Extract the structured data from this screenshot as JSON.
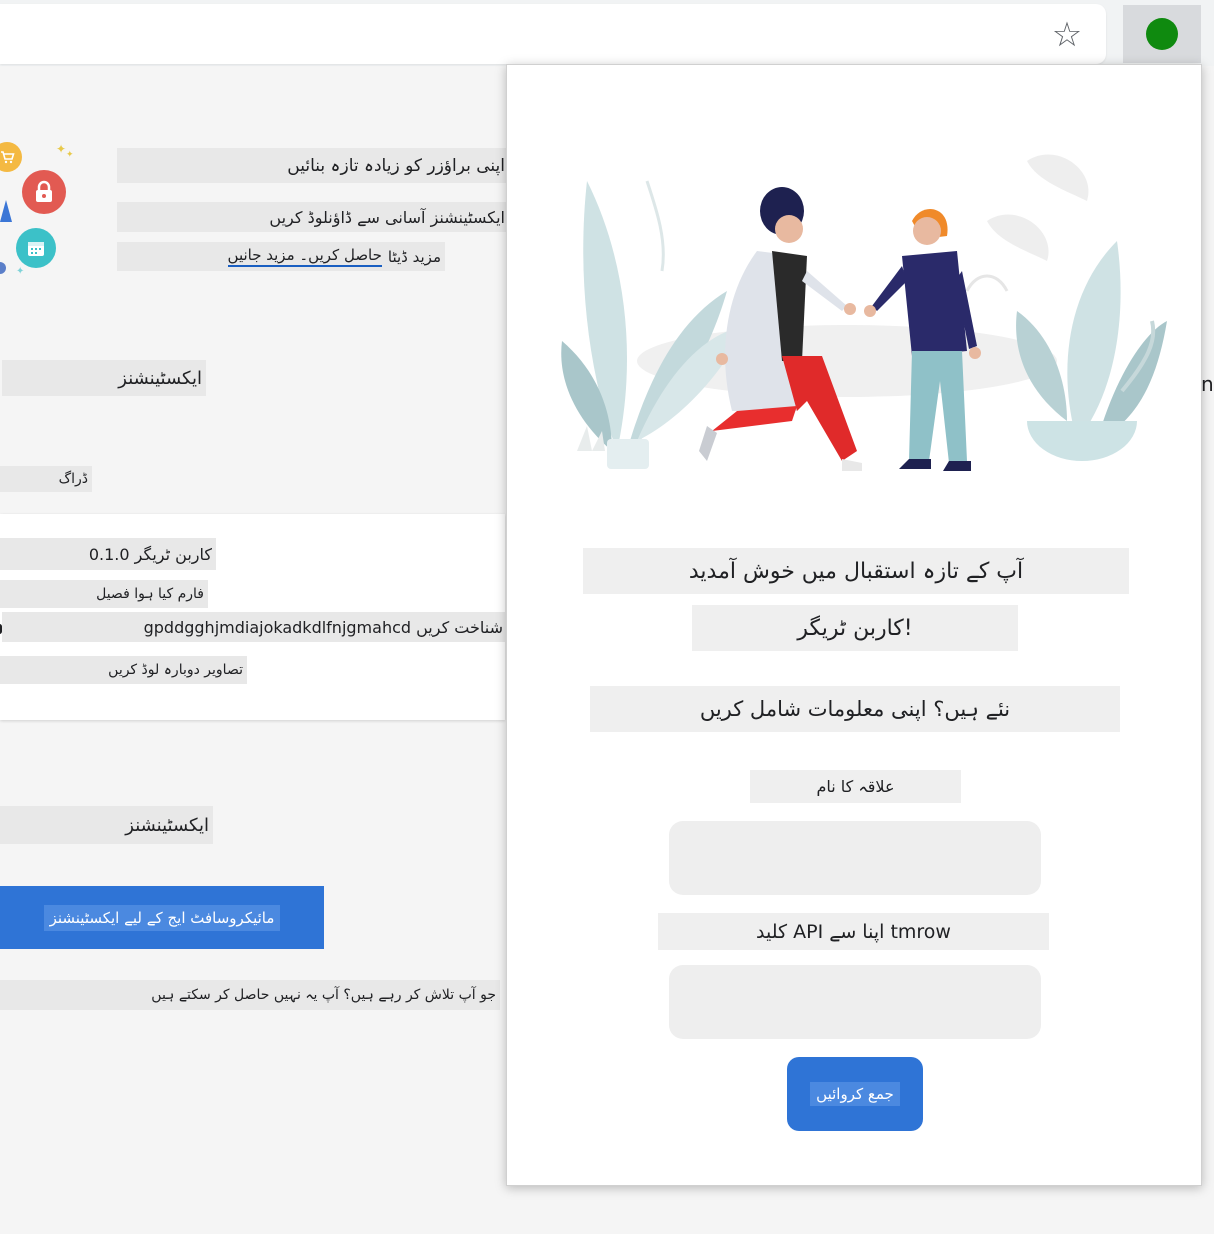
{
  "browser": {
    "star_glyph": "☆"
  },
  "page": {
    "intro_line_1": "اپنی براؤزر کو زیادہ تازہ بنائیں",
    "intro_line_2": "ایکسٹینشنز آسانی سے ڈاؤنلوڈ کریں",
    "intro_line_3_prefix": "مزید ڈیٹا",
    "intro_line_3_link": "حاصل کریں۔ مزید جانیں",
    "extensions_heading": "ایکسٹینشنز",
    "drag_label": "ڈراگ",
    "side_letter": "n",
    "card": {
      "version_line": "کاربن ٹریگر 0.1.0",
      "description": "فارم کیا ہوا فصیل",
      "id_line": "gpddgghjmdiajokadkdlfnjgmahcd شناخت کریں",
      "inspect_line": "تصاویر دوبارہ لوڈ کریں"
    },
    "extensions_heading_2": "ایکسٹینشنز",
    "store_button": "مائیکروسافٹ ایج کے لیے ایکسٹینشنز",
    "footer_text": "جو آپ تلاش کر رہے ہیں؟ آپ یہ نہیں حاصل کر سکتے ہیں"
  },
  "popup": {
    "heading_line_1": "آپ کے تازہ استقبال میں خوش آمدید",
    "heading_line_2": "کاربن ٹریگر!",
    "subheading": "نئے ہیں؟ اپنی معلومات شامل کریں",
    "region_label": "علاقہ کا نام",
    "region_input_value": "",
    "api_label": "کلید API اپنا سے tmrow",
    "api_input_value": "",
    "submit_label": "جمع کروائیں"
  },
  "colors": {
    "accent": "#2f74d6",
    "status_green": "#0f8a0f"
  }
}
